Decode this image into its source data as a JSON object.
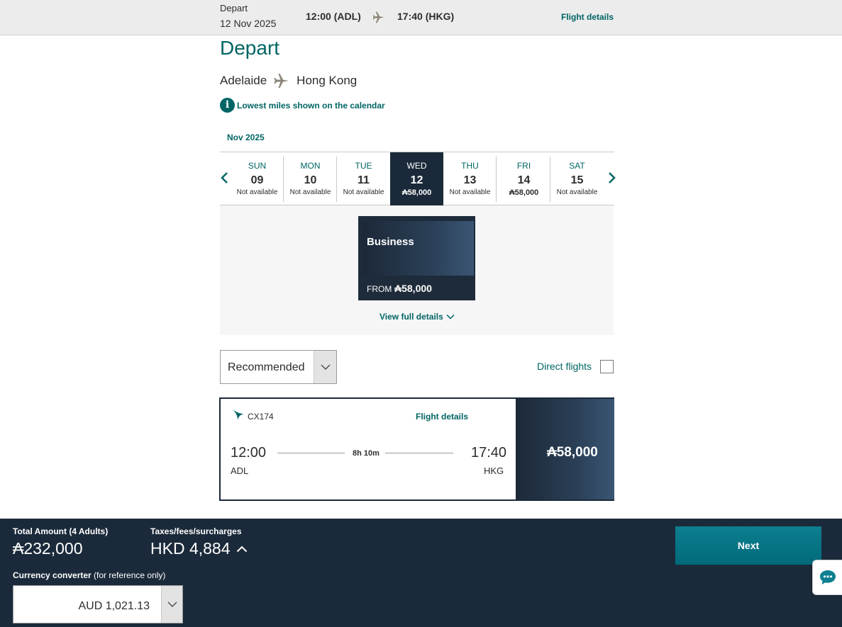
{
  "topbar": {
    "depart_label": "Depart",
    "date": "12 Nov 2025",
    "depart_time": "12:00 (ADL)",
    "arrive_time": "17:40 (HKG)",
    "flight_details_link": "Flight details"
  },
  "page_title": "Depart",
  "route": {
    "origin": "Adelaide",
    "destination": "Hong Kong"
  },
  "info_text": "Lowest miles shown on the calendar",
  "month_label": "Nov 2025",
  "calendar": {
    "days": [
      {
        "name": "SUN",
        "num": "09",
        "price": "Not available"
      },
      {
        "name": "MON",
        "num": "10",
        "price": "Not available"
      },
      {
        "name": "TUE",
        "num": "11",
        "price": "Not available"
      },
      {
        "name": "WED",
        "num": "12",
        "price": "₳58,000"
      },
      {
        "name": "THU",
        "num": "13",
        "price": "Not available"
      },
      {
        "name": "FRI",
        "num": "14",
        "price": "₳58,000"
      },
      {
        "name": "SAT",
        "num": "15",
        "price": "Not available"
      }
    ],
    "selected_index": 3
  },
  "cabin": {
    "name": "Business",
    "from_label": "FROM",
    "price": "₳58,000"
  },
  "view_full_details": "View full details",
  "sort": {
    "value": "Recommended"
  },
  "direct_flights_label": "Direct flights",
  "flight": {
    "number": "CX174",
    "details_link": "Flight details",
    "depart_time": "12:00",
    "arrive_time": "17:40",
    "depart_code": "ADL",
    "arrive_code": "HKG",
    "duration": "8h 10m",
    "price": "₳58,000"
  },
  "bottom": {
    "total_label": "Total Amount (4 Adults)",
    "total_value": "₳232,000",
    "tax_label": "Taxes/fees/surcharges",
    "tax_value": "HKD 4,884",
    "converter_label": "Currency converter",
    "converter_note": " (for reference only)",
    "converter_value": "AUD 1,021.13",
    "next_label": "Next"
  },
  "colors": {
    "accent": "#006564",
    "navy": "#1b2a3a",
    "next": "#0d7f90"
  }
}
